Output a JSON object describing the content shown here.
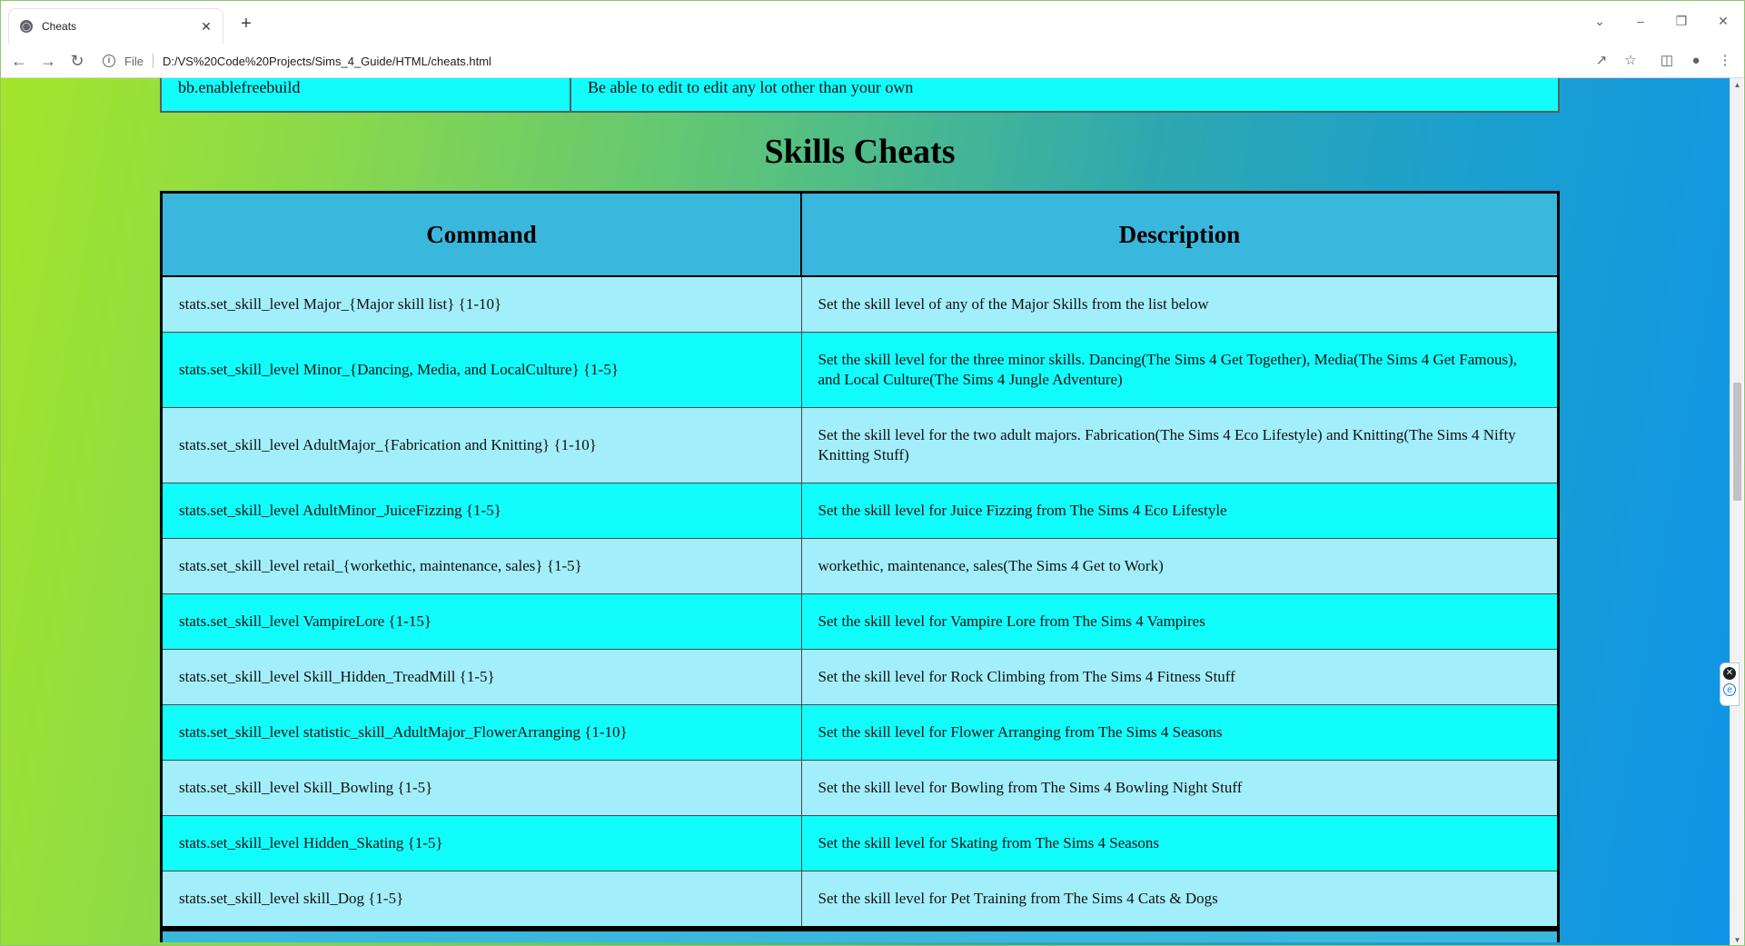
{
  "browser": {
    "tab_title": "Cheats",
    "scheme_label": "File",
    "url": "D:/VS%20Code%20Projects/Sims_4_Guide/HTML/cheats.html"
  },
  "previous_table": {
    "command": "bb.enablefreebuild",
    "description": "Be able to edit to edit any lot other than your own"
  },
  "skills": {
    "title": "Skills Cheats",
    "headers": {
      "command": "Command",
      "description": "Description"
    },
    "rows": [
      {
        "command": "stats.set_skill_level Major_{Major skill list} {1-10}",
        "description": "Set the skill level of any of the Major Skills from the list below"
      },
      {
        "command": "stats.set_skill_level Minor_{Dancing, Media, and LocalCulture} {1-5}",
        "description": "Set the skill level for the three minor skills. Dancing(The Sims 4 Get Together), Media(The Sims 4 Get Famous), and Local Culture(The Sims 4 Jungle Adventure)"
      },
      {
        "command": "stats.set_skill_level AdultMajor_{Fabrication and Knitting} {1-10}",
        "description": "Set the skill level for the two adult majors. Fabrication(The Sims 4 Eco Lifestyle) and Knitting(The Sims 4 Nifty Knitting Stuff)"
      },
      {
        "command": "stats.set_skill_level AdultMinor_JuiceFizzing {1-5}",
        "description": "Set the skill level for Juice Fizzing from The Sims 4 Eco Lifestyle"
      },
      {
        "command": "stats.set_skill_level retail_{workethic, maintenance, sales} {1-5}",
        "description": "workethic, maintenance, sales(The Sims 4 Get to Work)"
      },
      {
        "command": "stats.set_skill_level VampireLore {1-15}",
        "description": "Set the skill level for Vampire Lore from The Sims 4 Vampires"
      },
      {
        "command": "stats.set_skill_level Skill_Hidden_TreadMill {1-5}",
        "description": "Set the skill level for Rock Climbing from The Sims 4 Fitness Stuff"
      },
      {
        "command": "stats.set_skill_level statistic_skill_AdultMajor_FlowerArranging {1-10}",
        "description": "Set the skill level for Flower Arranging from The Sims 4 Seasons"
      },
      {
        "command": "stats.set_skill_level Skill_Bowling {1-5}",
        "description": "Set the skill level for Bowling from The Sims 4 Bowling Night Stuff"
      },
      {
        "command": "stats.set_skill_level Hidden_Skating {1-5}",
        "description": "Set the skill level for Skating from The Sims 4 Seasons"
      },
      {
        "command": "stats.set_skill_level skill_Dog {1-5}",
        "description": "Set the skill level for Pet Training from The Sims 4 Cats & Dogs"
      }
    ]
  },
  "icons": {
    "favicon": "globe-icon",
    "close": "close-icon",
    "new_tab": "plus-icon",
    "back": "back-arrow-icon",
    "forward": "forward-arrow-icon",
    "reload": "reload-icon",
    "info": "info-icon",
    "share": "share-icon",
    "bookmark": "star-icon",
    "side_panel": "side-panel-icon",
    "profile": "profile-icon",
    "menu": "kebab-menu-icon"
  },
  "colors": {
    "header_bg": "#3ab7dd",
    "row_light": "#a3eefb",
    "row_cyan": "#10fdfb",
    "gradient_left": "#a3e52b",
    "gradient_right": "#0f95e8"
  }
}
